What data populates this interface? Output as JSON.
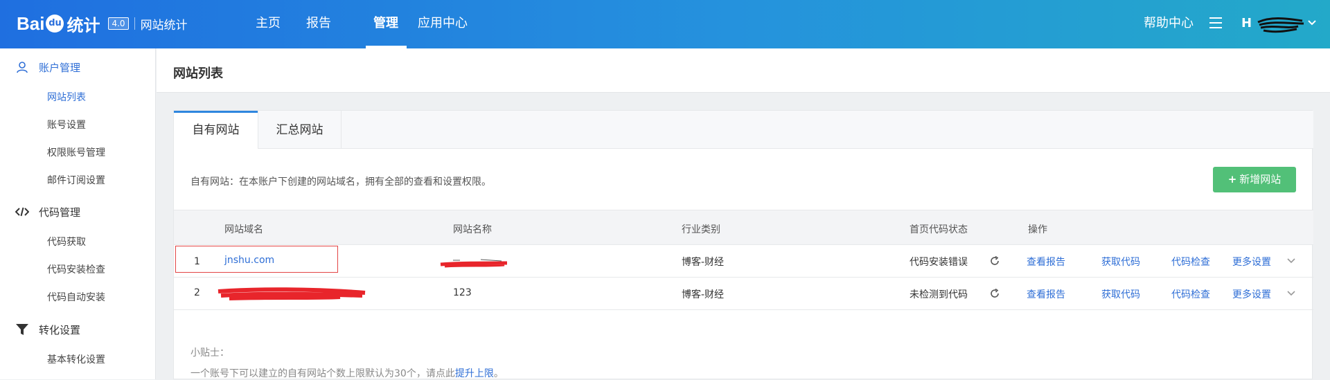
{
  "header": {
    "logo_text_1": "Bai",
    "logo_paw": "du",
    "logo_cn": "统计",
    "version": "4.0",
    "product": "网站统计",
    "nav": [
      "主页",
      "报告",
      "管理",
      "应用中心"
    ],
    "active_nav": "管理",
    "help": "帮助中心",
    "user_initial": "H"
  },
  "sidebar": {
    "groups": [
      {
        "label": "账户管理",
        "icon": "user-icon",
        "items": [
          "网站列表",
          "账号设置",
          "权限账号管理",
          "邮件订阅设置"
        ]
      },
      {
        "label": "代码管理",
        "icon": "code-icon",
        "items": [
          "代码获取",
          "代码安装检查",
          "代码自动安装"
        ]
      },
      {
        "label": "转化设置",
        "icon": "filter-icon",
        "items": [
          "基本转化设置"
        ]
      }
    ],
    "active_item": "网站列表"
  },
  "page": {
    "title": "网站列表",
    "tabs": [
      "自有网站",
      "汇总网站"
    ],
    "description": "自有网站：在本账户下创建的网站域名，拥有全部的查看和设置权限。",
    "add_button": "新增网站"
  },
  "table": {
    "headers": [
      "网站域名",
      "网站名称",
      "行业类别",
      "首页代码状态",
      "操作"
    ],
    "rows": [
      {
        "index": "1",
        "domain": "jnshu.com",
        "name": "",
        "industry": "博客-财经",
        "status": "代码安装错误",
        "actions": [
          "查看报告",
          "获取代码",
          "代码检查",
          "更多设置"
        ]
      },
      {
        "index": "2",
        "domain": "",
        "name": "123",
        "industry": "博客-财经",
        "status": "未检测到代码",
        "actions": [
          "查看报告",
          "获取代码",
          "代码检查",
          "更多设置"
        ]
      }
    ]
  },
  "tips": {
    "title": "小贴士：",
    "text": "一个账号下可以建立的自有网站个数上限默认为30个，请点此",
    "link": "提升上限",
    "end": "。"
  },
  "colors": {
    "header_start": "#1f6fe0",
    "header_end": "#23a9c9",
    "link": "#2e6ed6",
    "add_button": "#52c078",
    "highlight_box": "#e34444",
    "redaction": "#e8252b"
  }
}
